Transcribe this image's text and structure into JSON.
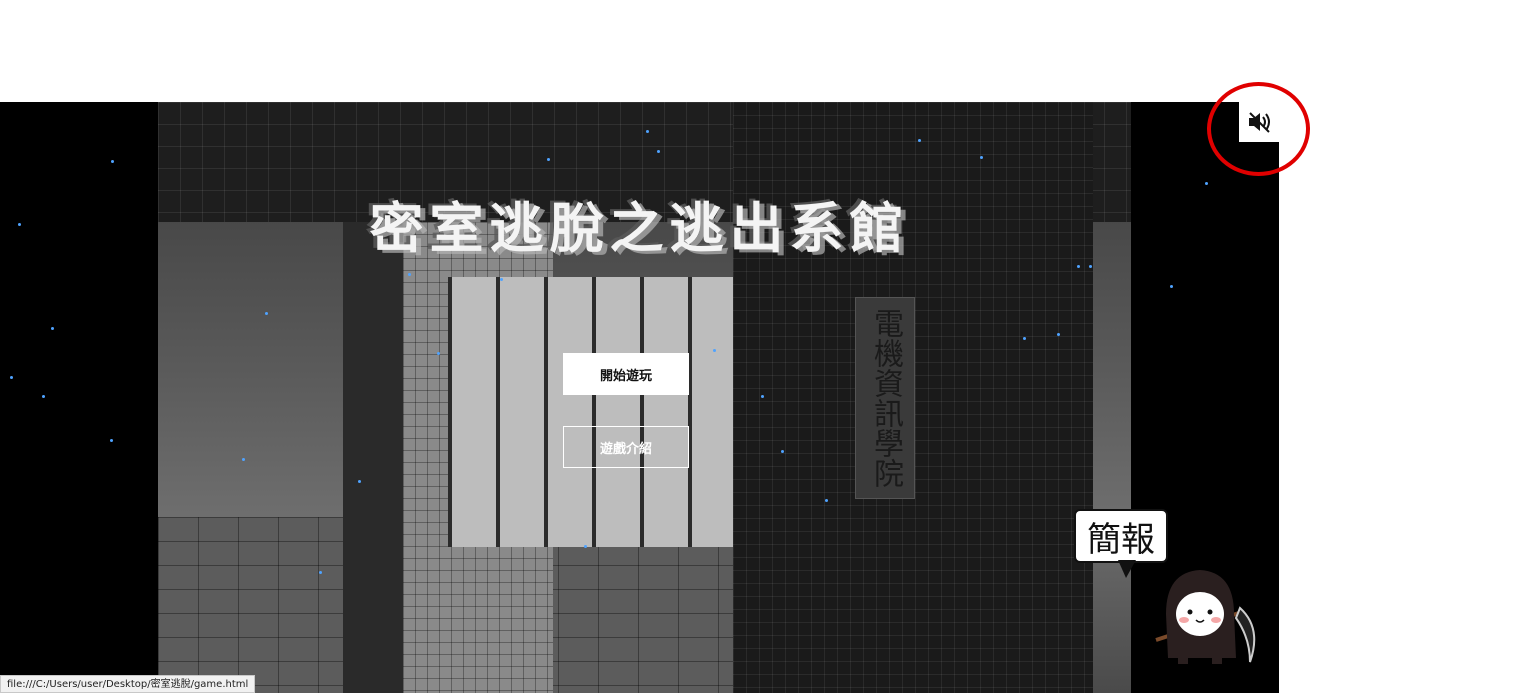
{
  "title": "密室逃脫之逃出系館",
  "sign_text": "電機資訊學院",
  "buttons": {
    "start": "開始遊玩",
    "intro": "遊戲介紹"
  },
  "sound_icon": "speaker-muted-icon",
  "presentation_bubble": "簡報",
  "status_url": "file:///C:/Users/user/Desktop/密室逃脫/game.html",
  "colors": {
    "highlight_circle": "#e00000",
    "star": "#4fa3ff",
    "stage_bg": "#000000"
  }
}
